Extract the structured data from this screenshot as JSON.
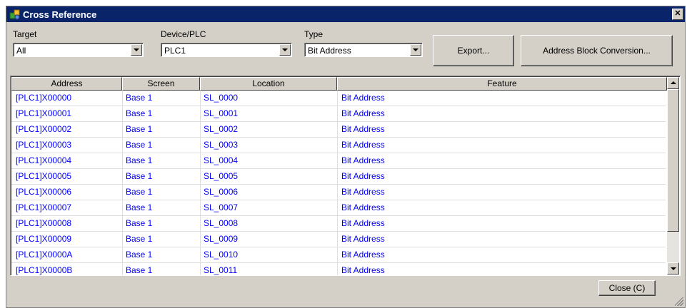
{
  "window": {
    "title": "Cross Reference"
  },
  "filters": {
    "target": {
      "label": "Target",
      "value": "All"
    },
    "device": {
      "label": "Device/PLC",
      "value": "PLC1"
    },
    "type": {
      "label": "Type",
      "value": "Bit Address"
    }
  },
  "buttons": {
    "export": "Export...",
    "address_block": "Address Block Conversion...",
    "close": "Close (C)"
  },
  "table": {
    "columns": [
      "Address",
      "Screen",
      "Location",
      "Feature"
    ],
    "rows": [
      [
        "[PLC1]X00000",
        "Base 1",
        "SL_0000",
        "Bit Address"
      ],
      [
        "[PLC1]X00001",
        "Base 1",
        "SL_0001",
        "Bit Address"
      ],
      [
        "[PLC1]X00002",
        "Base 1",
        "SL_0002",
        "Bit Address"
      ],
      [
        "[PLC1]X00003",
        "Base 1",
        "SL_0003",
        "Bit Address"
      ],
      [
        "[PLC1]X00004",
        "Base 1",
        "SL_0004",
        "Bit Address"
      ],
      [
        "[PLC1]X00005",
        "Base 1",
        "SL_0005",
        "Bit Address"
      ],
      [
        "[PLC1]X00006",
        "Base 1",
        "SL_0006",
        "Bit Address"
      ],
      [
        "[PLC1]X00007",
        "Base 1",
        "SL_0007",
        "Bit Address"
      ],
      [
        "[PLC1]X00008",
        "Base 1",
        "SL_0008",
        "Bit Address"
      ],
      [
        "[PLC1]X00009",
        "Base 1",
        "SL_0009",
        "Bit Address"
      ],
      [
        "[PLC1]X0000A",
        "Base 1",
        "SL_0010",
        "Bit Address"
      ],
      [
        "[PLC1]X0000B",
        "Base 1",
        "SL_0011",
        "Bit Address"
      ]
    ]
  },
  "colors": {
    "titlebar": "#0a246a",
    "link_text": "#0000ff",
    "face": "#d4d0c8"
  },
  "icons": {
    "app": "cross-reference-app-icon",
    "close": "close-icon"
  }
}
